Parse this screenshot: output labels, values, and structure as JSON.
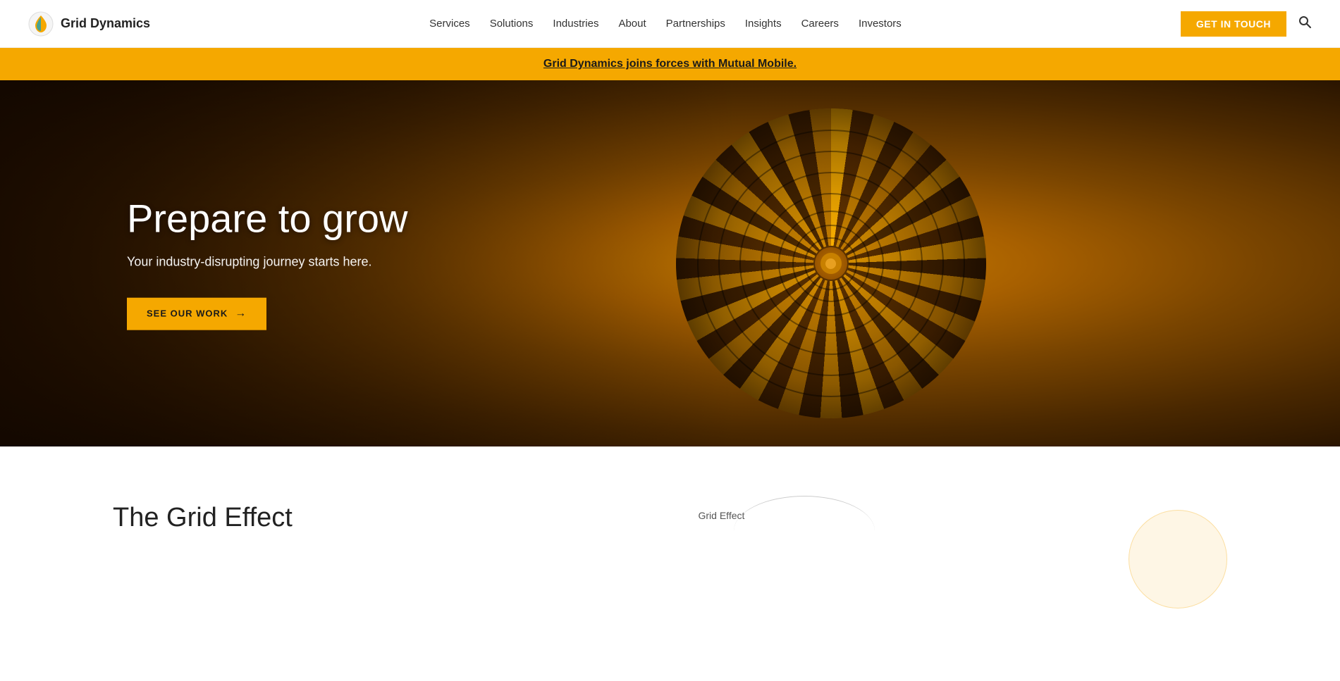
{
  "logo": {
    "text": "Grid Dynamics"
  },
  "nav": {
    "links": [
      {
        "label": "Services",
        "href": "#"
      },
      {
        "label": "Solutions",
        "href": "#"
      },
      {
        "label": "Industries",
        "href": "#"
      },
      {
        "label": "About",
        "href": "#"
      },
      {
        "label": "Partnerships",
        "href": "#"
      },
      {
        "label": "Insights",
        "href": "#"
      },
      {
        "label": "Careers",
        "href": "#"
      },
      {
        "label": "Investors",
        "href": "#"
      }
    ],
    "cta_label": "GET IN TOUCH",
    "search_label": "Search"
  },
  "announcement": {
    "text": "Grid Dynamics joins forces with Mutual Mobile."
  },
  "hero": {
    "title": "Prepare to grow",
    "subtitle": "Your industry-disrupting journey starts here.",
    "cta_label": "SEE OUR WORK"
  },
  "below_fold": {
    "title": "The Grid Effect",
    "grid_effect_label": "Grid Effect"
  }
}
